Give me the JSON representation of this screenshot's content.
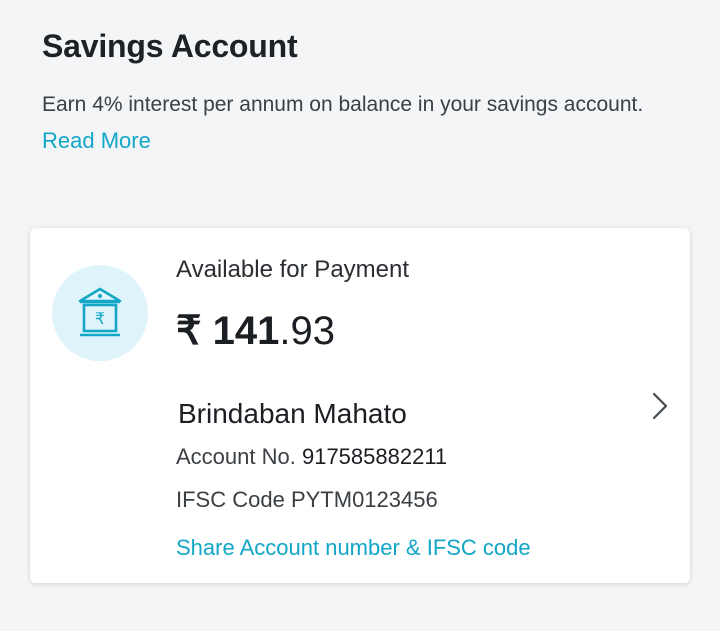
{
  "header": {
    "title": "Savings Account",
    "description": "Earn 4% interest per annum on balance in your savings account.",
    "read_more": "Read More"
  },
  "card": {
    "bank_icon": "bank-rupee-icon",
    "available_label": "Available for Payment",
    "amount_symbol": "₹",
    "amount_int": "141",
    "amount_dec": ".93",
    "holder_name": "Brindaban Mahato",
    "account_label": "Account No.",
    "account_number": "917585882211",
    "ifsc_label": "IFSC Code",
    "ifsc_code": "PYTM0123456",
    "share_link": "Share Account number & IFSC code",
    "chevron_icon": "chevron-right-icon"
  },
  "colors": {
    "accent": "#12a6c7",
    "background": "#f3f5f7",
    "icon_circle": "#dff3fb",
    "icon_stroke": "#12a6c7"
  }
}
